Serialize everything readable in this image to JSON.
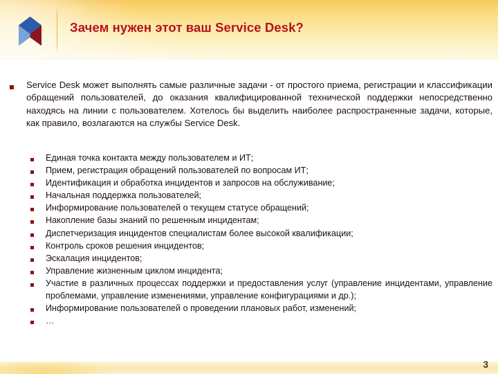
{
  "slide": {
    "title": "Зачем нужен этот ваш Service Desk?",
    "page_number": "3",
    "title_color": "#b4121f",
    "bullet_color": "#8c1111",
    "header_accent_color": "#f6c95b",
    "body_text_color": "#1d1012"
  },
  "logo": {
    "name": "arrow-chevron-logo",
    "blue_color": "#2d5ca8",
    "light_blue_color": "#7aa4d8",
    "dark_red_color": "#8c1420"
  },
  "intro": {
    "bullet": "square-bullet",
    "text": "Service Desk может выполнять самые различные задачи - от простого приема, регистрации и классификации обращений пользователей, до оказания квалифицированной технической поддержки непосредственно находясь на линии с пользователем. Хотелось бы выделить наиболее распространенные задачи, которые, как правило, возлагаются на службы Service Desk."
  },
  "tasks": [
    {
      "text": "Единая точка контакта между пользователем и ИТ;",
      "justify": false,
      "dots": false
    },
    {
      "text": "Прием, регистрация обращений пользователей по вопросам ИТ;",
      "justify": false,
      "dots": false
    },
    {
      "text": "Идентификация и обработка инцидентов и запросов на обслуживание;",
      "justify": false,
      "dots": false
    },
    {
      "text": "Начальная поддержка пользователей;",
      "justify": false,
      "dots": false
    },
    {
      "text": "Информирование пользователей о текущем статусе обращений;",
      "justify": false,
      "dots": false
    },
    {
      "text": "Накопление базы знаний по решенным инцидентам;",
      "justify": false,
      "dots": false
    },
    {
      "text": "Диспетчеризация инцидентов специалистам более высокой квалификации;",
      "justify": false,
      "dots": false
    },
    {
      "text": "Контроль сроков решения инцидентов;",
      "justify": false,
      "dots": false
    },
    {
      "text": "Эскалация инцидентов;",
      "justify": false,
      "dots": false
    },
    {
      "text": "Управление жизненным циклом инцидента;",
      "justify": false,
      "dots": false
    },
    {
      "text": "Участие в различных процессах поддержки и предоставления услуг (управление инцидентами, управление проблемами, управление изменениями, управление конфигурациями и др.);",
      "justify": true,
      "dots": false
    },
    {
      "text": "Информирование пользователей о проведении плановых работ, изменений;",
      "justify": false,
      "dots": false
    },
    {
      "text": "…",
      "justify": false,
      "dots": true
    }
  ]
}
